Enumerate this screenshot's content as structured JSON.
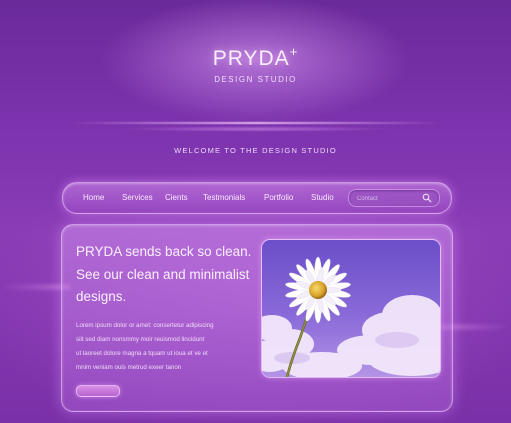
{
  "brand": {
    "name": "PRYDA",
    "plus": "+",
    "tagline": "DESIGN STUDIO"
  },
  "welcome": "WELCOME TO THE DESIGN STUDIO",
  "nav": {
    "items": [
      {
        "label": "Home"
      },
      {
        "label": "Services"
      },
      {
        "label": "Cients"
      },
      {
        "label": "Testmonials"
      },
      {
        "label": "Portfolio"
      },
      {
        "label": "Studio"
      }
    ],
    "search": {
      "placeholder": "Contact"
    }
  },
  "hero": {
    "headline": [
      "PRYDA sends back so clean.",
      "See our clean and minimalist",
      "designs."
    ],
    "body": [
      "Lorem ipsum dolor or amet: consertetur adipiscing",
      "siit  sed diam nonsmmy moir reuismod lincidunt",
      "ut laoreet dolore magna a tquam ut ioua et ve et",
      "mnim veniam ouis  metrud exeer tanon"
    ],
    "image": "daisy-flower-image"
  },
  "colors": {
    "accent": "#b564cf",
    "background": "#7d33ae"
  }
}
